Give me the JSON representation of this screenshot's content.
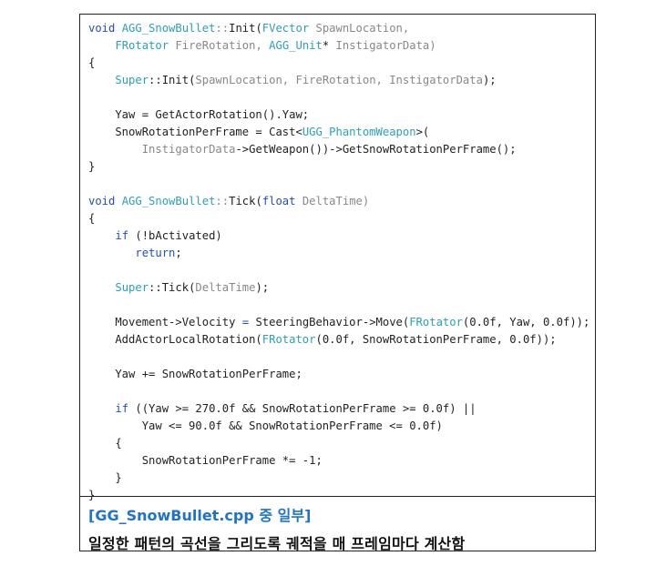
{
  "code": {
    "lines": [
      [
        {
          "t": "void ",
          "c": "kw"
        },
        {
          "t": "AGG_SnowBullet",
          "c": "cls"
        },
        {
          "t": "::",
          "c": "dim"
        },
        {
          "t": "Init(",
          "c": ""
        },
        {
          "t": "FVector ",
          "c": "cls"
        },
        {
          "t": "SpawnLocation,",
          "c": "dim"
        }
      ],
      [
        {
          "t": "    ",
          "c": ""
        },
        {
          "t": "FRotator ",
          "c": "cls"
        },
        {
          "t": "FireRotation, ",
          "c": "dim"
        },
        {
          "t": "AGG_Unit",
          "c": "cls"
        },
        {
          "t": "* ",
          "c": ""
        },
        {
          "t": "InstigatorData)",
          "c": "dim"
        }
      ],
      [
        {
          "t": "{",
          "c": ""
        }
      ],
      [
        {
          "t": "    ",
          "c": ""
        },
        {
          "t": "Super",
          "c": "cls"
        },
        {
          "t": "::Init(",
          "c": ""
        },
        {
          "t": "SpawnLocation, FireRotation, InstigatorData",
          "c": "dim"
        },
        {
          "t": ");",
          "c": ""
        }
      ],
      [],
      [
        {
          "t": "    Yaw = GetActorRotation().Yaw;",
          "c": ""
        }
      ],
      [
        {
          "t": "    SnowRotationPerFrame = Cast<",
          "c": ""
        },
        {
          "t": "UGG_PhantomWeapon",
          "c": "cls"
        },
        {
          "t": ">(",
          "c": ""
        }
      ],
      [
        {
          "t": "        ",
          "c": ""
        },
        {
          "t": "InstigatorData",
          "c": "dim"
        },
        {
          "t": "->GetWeapon())->GetSnowRotationPerFrame();",
          "c": ""
        }
      ],
      [
        {
          "t": "}",
          "c": ""
        }
      ],
      [],
      [
        {
          "t": "void ",
          "c": "kw"
        },
        {
          "t": "AGG_SnowBullet",
          "c": "cls"
        },
        {
          "t": "::",
          "c": "dim"
        },
        {
          "t": "Tick(",
          "c": ""
        },
        {
          "t": "float ",
          "c": "kw"
        },
        {
          "t": "DeltaTime)",
          "c": "dim"
        }
      ],
      [
        {
          "t": "{",
          "c": ""
        }
      ],
      [
        {
          "t": "    ",
          "c": ""
        },
        {
          "t": "if ",
          "c": "kw"
        },
        {
          "t": "(!bActivated)",
          "c": ""
        }
      ],
      [
        {
          "t": "       ",
          "c": ""
        },
        {
          "t": "return",
          "c": "kw"
        },
        {
          "t": ";",
          "c": ""
        }
      ],
      [],
      [
        {
          "t": "    ",
          "c": ""
        },
        {
          "t": "Super",
          "c": "cls"
        },
        {
          "t": "::Tick(",
          "c": ""
        },
        {
          "t": "DeltaTime",
          "c": "dim"
        },
        {
          "t": ");",
          "c": ""
        }
      ],
      [],
      [
        {
          "t": "    Movement->Velocity ",
          "c": ""
        },
        {
          "t": "= ",
          "c": "kw"
        },
        {
          "t": "SteeringBehavior->Move(",
          "c": ""
        },
        {
          "t": "FRotator",
          "c": "cls"
        },
        {
          "t": "(0.0f, Yaw, 0.0f));",
          "c": ""
        }
      ],
      [
        {
          "t": "    AddActorLocalRotation(",
          "c": ""
        },
        {
          "t": "FRotator",
          "c": "cls"
        },
        {
          "t": "(0.0f, SnowRotationPerFrame, 0.0f));",
          "c": ""
        }
      ],
      [],
      [
        {
          "t": "    Yaw += SnowRotationPerFrame;",
          "c": ""
        }
      ],
      [],
      [
        {
          "t": "    ",
          "c": ""
        },
        {
          "t": "if ",
          "c": "kw"
        },
        {
          "t": "((Yaw >= 270.0f && SnowRotationPerFrame >= 0.0f) ||",
          "c": ""
        }
      ],
      [
        {
          "t": "        Yaw <= 90.0f && SnowRotationPerFrame <= 0.0f)",
          "c": ""
        }
      ],
      [
        {
          "t": "    {",
          "c": ""
        }
      ],
      [
        {
          "t": "        SnowRotationPerFrame *= -1;",
          "c": ""
        }
      ],
      [
        {
          "t": "    }",
          "c": ""
        }
      ],
      [
        {
          "t": "}",
          "c": ""
        }
      ]
    ]
  },
  "caption": {
    "title": "[GG_SnowBullet.cpp 중 일부]",
    "description": "일정한 패턴의 곡선을 그리도록 궤적을 매 프레임마다 계산함"
  }
}
